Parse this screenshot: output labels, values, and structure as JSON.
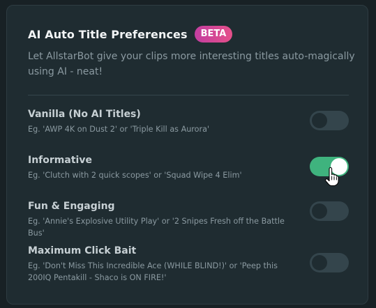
{
  "header": {
    "title": "AI Auto Title Preferences",
    "badge": "BETA",
    "description": "Let AllstarBot give your clips more interesting titles auto-magically using AI - neat!"
  },
  "options": [
    {
      "label": "Vanilla (No AI Titles)",
      "example": "Eg. 'AWP 4K on Dust 2' or 'Triple Kill as Aurora'",
      "enabled": false
    },
    {
      "label": "Informative",
      "example": "Eg. 'Clutch with 2 quick scopes' or 'Squad Wipe 4 Elim'",
      "enabled": true
    },
    {
      "label": "Fun & Engaging",
      "example": "Eg. 'Annie's Explosive Utility Play' or '2 Snipes Fresh off the Battle Bus'",
      "enabled": false
    },
    {
      "label": "Maximum Click Bait",
      "example": "Eg. 'Don't Miss This Incredible Ace (WHILE BLIND!)' or 'Peep this 200IQ Pentakill - Shaco is ON FIRE!'",
      "enabled": false
    }
  ],
  "colors": {
    "accent_on": "#3fb37e",
    "badge_gradient_start": "#c23ea0",
    "badge_gradient_end": "#e5508a",
    "card_bg": "#1f2c31",
    "page_bg": "#182125"
  },
  "cursor": "hand-pointer-icon"
}
